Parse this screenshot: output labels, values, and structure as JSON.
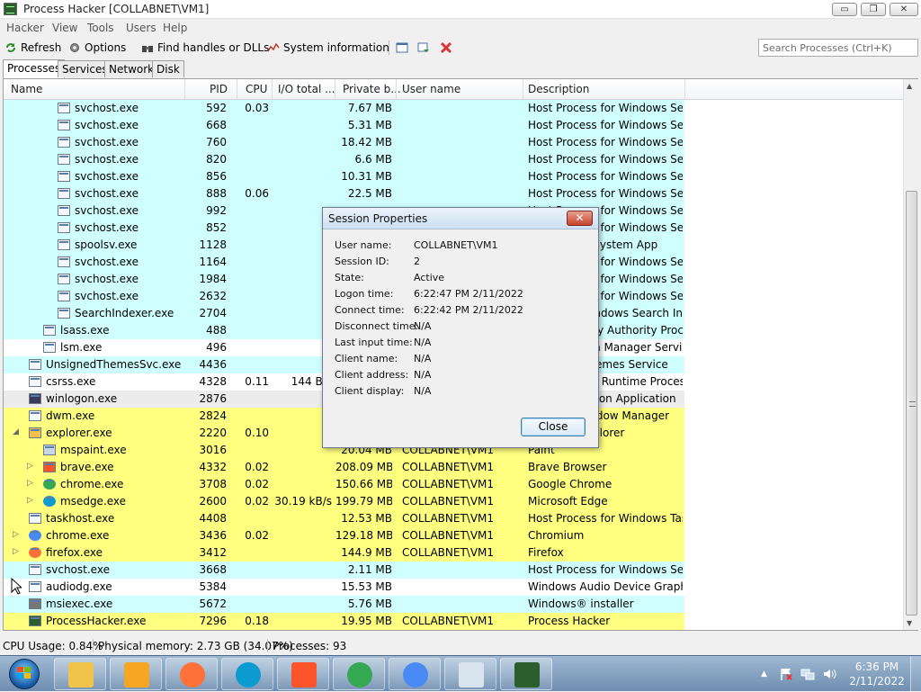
{
  "window": {
    "title": "Process Hacker [COLLABNET\\VM1]",
    "controls": {
      "minimize": "▭",
      "maximize": "❐",
      "close": "✕"
    }
  },
  "menu": [
    "Hacker",
    "View",
    "Tools",
    "Users",
    "Help"
  ],
  "toolbar": {
    "refresh": "Refresh",
    "options": "Options",
    "find_handles": "Find handles or DLLs",
    "system_info": "System information",
    "search_placeholder": "Search Processes (Ctrl+K)"
  },
  "tabs": [
    "Processes",
    "Services",
    "Network",
    "Disk"
  ],
  "columns": {
    "name": "Name",
    "pid": "PID",
    "cpu": "CPU",
    "io": "I/O total ...",
    "private": "Private b...",
    "user": "User name",
    "description": "Description"
  },
  "rows": [
    {
      "name": "svchost.exe",
      "pid": "592",
      "cpu": "0.03",
      "io": "",
      "private": "7.67 MB",
      "user": "",
      "desc": "Host Process for Windows Ser...",
      "color": "#d0ffff",
      "indent": 3,
      "icon": "window-icon",
      "expander": ""
    },
    {
      "name": "svchost.exe",
      "pid": "668",
      "cpu": "",
      "io": "",
      "private": "5.31 MB",
      "user": "",
      "desc": "Host Process for Windows Ser...",
      "color": "#d0ffff",
      "indent": 3,
      "icon": "window-icon",
      "expander": ""
    },
    {
      "name": "svchost.exe",
      "pid": "760",
      "cpu": "",
      "io": "",
      "private": "18.42 MB",
      "user": "",
      "desc": "Host Process for Windows Ser...",
      "color": "#d0ffff",
      "indent": 3,
      "icon": "window-icon",
      "expander": ""
    },
    {
      "name": "svchost.exe",
      "pid": "820",
      "cpu": "",
      "io": "",
      "private": "6.6 MB",
      "user": "",
      "desc": "Host Process for Windows Ser...",
      "color": "#d0ffff",
      "indent": 3,
      "icon": "window-icon",
      "expander": ""
    },
    {
      "name": "svchost.exe",
      "pid": "856",
      "cpu": "",
      "io": "",
      "private": "10.31 MB",
      "user": "",
      "desc": "Host Process for Windows Ser...",
      "color": "#d0ffff",
      "indent": 3,
      "icon": "window-icon",
      "expander": ""
    },
    {
      "name": "svchost.exe",
      "pid": "888",
      "cpu": "0.06",
      "io": "",
      "private": "22.5 MB",
      "user": "",
      "desc": "Host Process for Windows Ser...",
      "color": "#d0ffff",
      "indent": 3,
      "icon": "window-icon",
      "expander": ""
    },
    {
      "name": "svchost.exe",
      "pid": "992",
      "cpu": "",
      "io": "",
      "private": "",
      "user": "",
      "desc": "Host Process for Windows Ser...",
      "color": "#d0ffff",
      "indent": 3,
      "icon": "window-icon",
      "expander": ""
    },
    {
      "name": "svchost.exe",
      "pid": "852",
      "cpu": "",
      "io": "",
      "private": "",
      "user": "",
      "desc": "Host Process for Windows Ser...",
      "color": "#d0ffff",
      "indent": 3,
      "icon": "window-icon",
      "expander": ""
    },
    {
      "name": "spoolsv.exe",
      "pid": "1128",
      "cpu": "",
      "io": "",
      "private": "",
      "user": "",
      "desc": "Spooler SubSystem App",
      "color": "#d0ffff",
      "indent": 3,
      "icon": "window-icon",
      "expander": ""
    },
    {
      "name": "svchost.exe",
      "pid": "1164",
      "cpu": "",
      "io": "",
      "private": "",
      "user": "",
      "desc": "Host Process for Windows Ser...",
      "color": "#d0ffff",
      "indent": 3,
      "icon": "window-icon",
      "expander": ""
    },
    {
      "name": "svchost.exe",
      "pid": "1984",
      "cpu": "",
      "io": "",
      "private": "",
      "user": "",
      "desc": "Host Process for Windows Ser...",
      "color": "#d0ffff",
      "indent": 3,
      "icon": "window-icon",
      "expander": ""
    },
    {
      "name": "svchost.exe",
      "pid": "2632",
      "cpu": "",
      "io": "",
      "private": "",
      "user": "",
      "desc": "Host Process for Windows Ser...",
      "color": "#d0ffff",
      "indent": 3,
      "icon": "window-icon",
      "expander": ""
    },
    {
      "name": "SearchIndexer.exe",
      "pid": "2704",
      "cpu": "",
      "io": "",
      "private": "",
      "user": "",
      "desc": "Microsoft Windows Search In...",
      "color": "#d0ffff",
      "indent": 3,
      "icon": "window-icon",
      "expander": ""
    },
    {
      "name": "lsass.exe",
      "pid": "488",
      "cpu": "",
      "io": "",
      "private": "",
      "user": "",
      "desc": "Local Security Authority Proce...",
      "color": "#d0ffff",
      "indent": 2,
      "icon": "window-icon",
      "expander": ""
    },
    {
      "name": "lsm.exe",
      "pid": "496",
      "cpu": "",
      "io": "",
      "private": "",
      "user": "",
      "desc": "Local Session Manager Service",
      "color": "#ffffff",
      "indent": 2,
      "icon": "window-icon",
      "expander": ""
    },
    {
      "name": "UnsignedThemesSvc.exe",
      "pid": "4436",
      "cpu": "",
      "io": "",
      "private": "",
      "user": "",
      "desc": "Unsigned Themes Service",
      "color": "#d0ffff",
      "indent": 1,
      "icon": "window-icon",
      "expander": ""
    },
    {
      "name": "csrss.exe",
      "pid": "4328",
      "cpu": "0.11",
      "io": "144 B/s",
      "private": "",
      "user": "",
      "desc": "Client Server Runtime Process",
      "color": "#ffffff",
      "indent": 1,
      "icon": "window-icon",
      "expander": ""
    },
    {
      "name": "winlogon.exe",
      "pid": "2876",
      "cpu": "",
      "io": "",
      "private": "",
      "user": "",
      "desc": "Windows Logon Application",
      "color": "#ececec",
      "indent": 1,
      "icon": "winlogon-icon",
      "expander": ""
    },
    {
      "name": "dwm.exe",
      "pid": "2824",
      "cpu": "",
      "io": "",
      "private": "",
      "user": "",
      "desc": "Desktop Window Manager",
      "color": "#ffff80",
      "indent": 1,
      "icon": "window-icon",
      "expander": ""
    },
    {
      "name": "explorer.exe",
      "pid": "2220",
      "cpu": "0.10",
      "io": "",
      "private": "",
      "user": "",
      "desc": "Windows Explorer",
      "color": "#ffff80",
      "indent": 1,
      "icon": "explorer-icon",
      "expander": "◢"
    },
    {
      "name": "mspaint.exe",
      "pid": "3016",
      "cpu": "",
      "io": "",
      "private": "20.04 MB",
      "user": "COLLABNET\\VM1",
      "desc": "Paint",
      "color": "#ffff80",
      "indent": 2,
      "icon": "paint-icon",
      "expander": ""
    },
    {
      "name": "brave.exe",
      "pid": "4332",
      "cpu": "0.02",
      "io": "",
      "private": "208.09 MB",
      "user": "COLLABNET\\VM1",
      "desc": "Brave Browser",
      "color": "#ffff80",
      "indent": 2,
      "icon": "brave-icon",
      "expander": "▷"
    },
    {
      "name": "chrome.exe",
      "pid": "3708",
      "cpu": "0.02",
      "io": "",
      "private": "150.66 MB",
      "user": "COLLABNET\\VM1",
      "desc": "Google Chrome",
      "color": "#ffff80",
      "indent": 2,
      "icon": "chrome-icon",
      "expander": "▷"
    },
    {
      "name": "msedge.exe",
      "pid": "2600",
      "cpu": "0.02",
      "io": "30.19 kB/s",
      "private": "199.79 MB",
      "user": "COLLABNET\\VM1",
      "desc": "Microsoft Edge",
      "color": "#ffff80",
      "indent": 2,
      "icon": "edge-icon",
      "expander": "▷"
    },
    {
      "name": "taskhost.exe",
      "pid": "4408",
      "cpu": "",
      "io": "",
      "private": "12.53 MB",
      "user": "COLLABNET\\VM1",
      "desc": "Host Process for Windows Tas...",
      "color": "#ffff80",
      "indent": 1,
      "icon": "window-icon",
      "expander": ""
    },
    {
      "name": "chrome.exe",
      "pid": "3436",
      "cpu": "0.02",
      "io": "",
      "private": "129.18 MB",
      "user": "COLLABNET\\VM1",
      "desc": "Chromium",
      "color": "#ffff80",
      "indent": 1,
      "icon": "chromium-icon",
      "expander": "▷"
    },
    {
      "name": "firefox.exe",
      "pid": "3412",
      "cpu": "",
      "io": "",
      "private": "144.9 MB",
      "user": "COLLABNET\\VM1",
      "desc": "Firefox",
      "color": "#ffff80",
      "indent": 1,
      "icon": "firefox-icon",
      "expander": "▷"
    },
    {
      "name": "svchost.exe",
      "pid": "3668",
      "cpu": "",
      "io": "",
      "private": "2.11 MB",
      "user": "",
      "desc": "Host Process for Windows Ser...",
      "color": "#d0ffff",
      "indent": 1,
      "icon": "window-icon",
      "expander": ""
    },
    {
      "name": "audiodg.exe",
      "pid": "5384",
      "cpu": "",
      "io": "",
      "private": "15.53 MB",
      "user": "",
      "desc": "Windows Audio Device Graph...",
      "color": "#ffffff",
      "indent": 1,
      "icon": "window-icon",
      "expander": ""
    },
    {
      "name": "msiexec.exe",
      "pid": "5672",
      "cpu": "",
      "io": "",
      "private": "5.76 MB",
      "user": "",
      "desc": "Windows® installer",
      "color": "#d0ffff",
      "indent": 1,
      "icon": "installer-icon",
      "expander": ""
    },
    {
      "name": "ProcessHacker.exe",
      "pid": "7296",
      "cpu": "0.18",
      "io": "",
      "private": "19.95 MB",
      "user": "COLLABNET\\VM1",
      "desc": "Process Hacker",
      "color": "#ffff80",
      "indent": 1,
      "icon": "processhacker-icon",
      "expander": ""
    }
  ],
  "statusbar": {
    "cpu": "CPU Usage: 0.84%",
    "memory": "Physical memory: 2.73 GB (34.07%)",
    "processes": "Processes: 93"
  },
  "dialog": {
    "title": "Session Properties",
    "close_glyph": "✕",
    "fields": [
      {
        "label": "User name:",
        "value": "COLLABNET\\VM1"
      },
      {
        "label": "Session ID:",
        "value": "2"
      },
      {
        "label": "State:",
        "value": "Active"
      },
      {
        "label": "Logon time:",
        "value": "6:22:47 PM 2/11/2022"
      },
      {
        "label": "Connect time:",
        "value": "6:22:42 PM 2/11/2022"
      },
      {
        "label": "Disconnect time:",
        "value": "N/A"
      },
      {
        "label": "Last input time:",
        "value": "N/A"
      },
      {
        "label": "Client name:",
        "value": "N/A"
      },
      {
        "label": "Client address:",
        "value": "N/A"
      },
      {
        "label": "Client display:",
        "value": "N/A"
      }
    ],
    "button": "Close"
  },
  "taskbar": {
    "apps": [
      "explorer-icon",
      "media-player-icon",
      "firefox-icon",
      "edge-icon",
      "brave-icon",
      "chrome-icon",
      "chromium-icon",
      "paint-icon",
      "processhacker-icon"
    ],
    "tray_arrow": "▲",
    "time": "6:36 PM",
    "date": "2/11/2022"
  },
  "colors": {
    "service_row": "#d0ffff",
    "own_process_row": "#ffff80",
    "system_row": "#ececec",
    "taskbar": "#7d9bbd"
  }
}
